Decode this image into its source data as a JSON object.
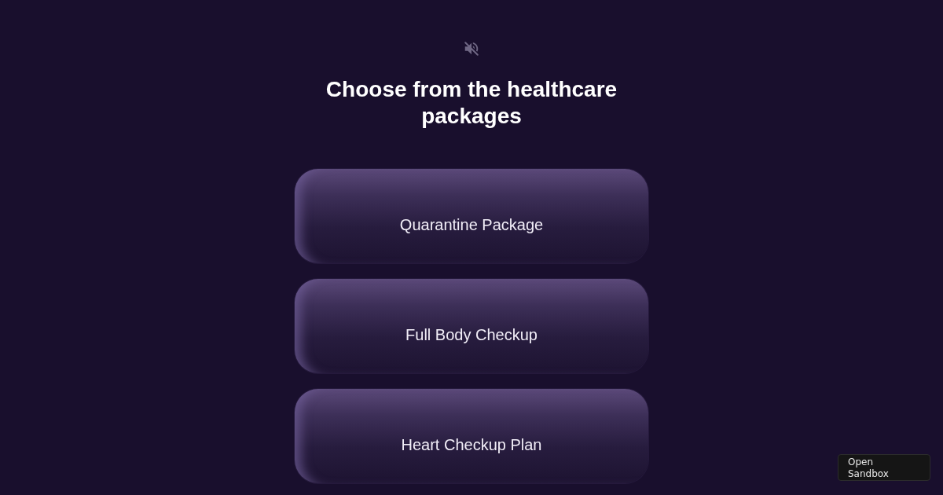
{
  "sound": {
    "muted": true
  },
  "title": "Choose from the healthcare packages",
  "packages": [
    {
      "label": "Quarantine Package"
    },
    {
      "label": "Full Body Checkup"
    },
    {
      "label": "Heart Checkup Plan"
    }
  ],
  "sandbox_button": {
    "label": "Open Sandbox"
  }
}
